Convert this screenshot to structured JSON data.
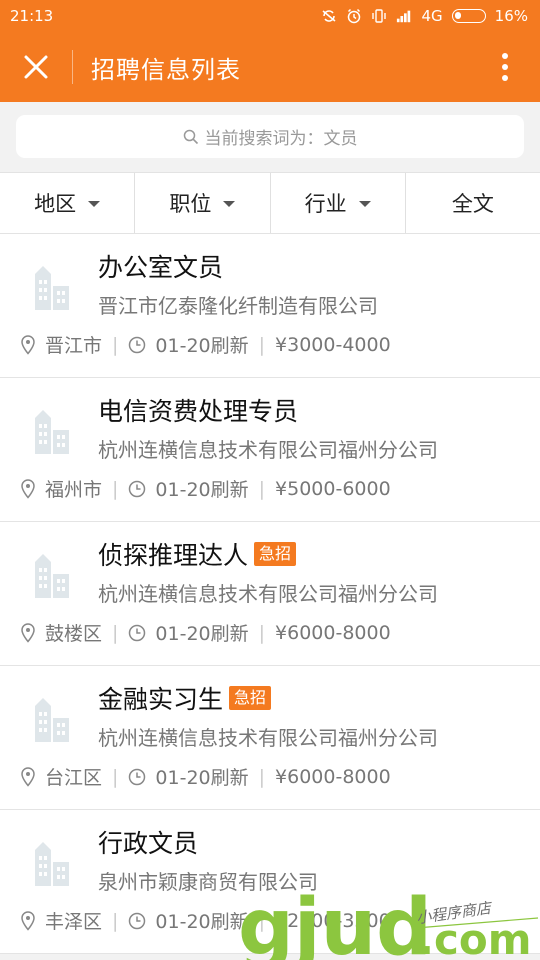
{
  "statusbar": {
    "time": "21:13",
    "network": "4G",
    "battery": "16%"
  },
  "appbar": {
    "title": "招聘信息列表"
  },
  "search": {
    "text": "当前搜索词为：文员"
  },
  "filters": [
    {
      "label": "地区",
      "has_caret": true
    },
    {
      "label": "职位",
      "has_caret": true
    },
    {
      "label": "行业",
      "has_caret": true
    },
    {
      "label": "全文",
      "has_caret": false
    }
  ],
  "jobs": [
    {
      "title": "办公室文员",
      "badge": "",
      "company": "晋江市亿泰隆化纤制造有限公司",
      "location": "晋江市",
      "date": "01-20刷新",
      "salary": "¥3000-4000"
    },
    {
      "title": "电信资费处理专员",
      "badge": "",
      "company": "杭州连横信息技术有限公司福州分公司",
      "location": "福州市",
      "date": "01-20刷新",
      "salary": "¥5000-6000"
    },
    {
      "title": "侦探推理达人",
      "badge": "急招",
      "company": "杭州连横信息技术有限公司福州分公司",
      "location": "鼓楼区",
      "date": "01-20刷新",
      "salary": "¥6000-8000"
    },
    {
      "title": "金融实习生",
      "badge": "急招",
      "company": "杭州连横信息技术有限公司福州分公司",
      "location": "台江区",
      "date": "01-20刷新",
      "salary": "¥6000-8000"
    },
    {
      "title": "行政文员",
      "badge": "",
      "company": "泉州市颖康商贸有限公司",
      "location": "丰泽区",
      "date": "01-20刷新",
      "salary": "¥2500-3500"
    }
  ],
  "watermark": {
    "brand": "gjud",
    "suffix": ".com",
    "tagline": "小程序商店"
  },
  "colors": {
    "accent": "#f47a20",
    "badge": "#f47a20",
    "watermark_green": "#8cc63f"
  }
}
